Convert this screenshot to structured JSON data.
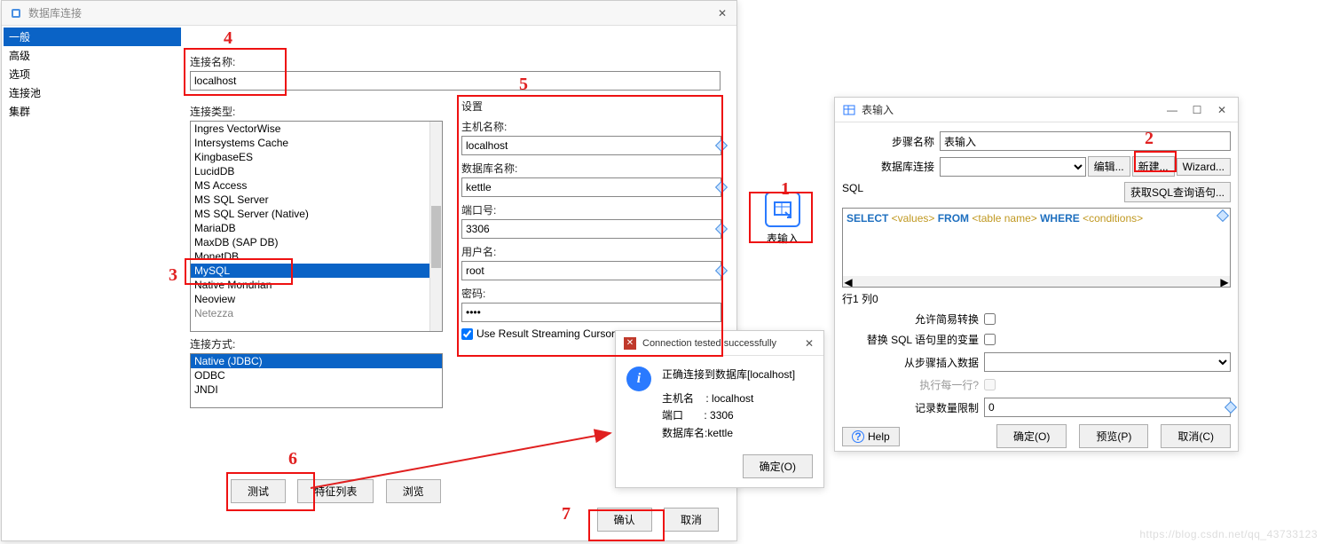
{
  "dbWindow": {
    "title": "数据库连接",
    "sidebar": [
      "一般",
      "高级",
      "选项",
      "连接池",
      "集群"
    ],
    "connNameLabel": "连接名称:",
    "connNameValue": "localhost",
    "connTypeLabel": "连接类型:",
    "dbTypes": [
      "Ingres VectorWise",
      "Intersystems Cache",
      "KingbaseES",
      "LucidDB",
      "MS Access",
      "MS SQL Server",
      "MS SQL Server (Native)",
      "MariaDB",
      "MaxDB (SAP DB)",
      "MonetDB",
      "MySQL",
      "Native Mondrian",
      "Neoview",
      "Netezza"
    ],
    "selectedDbTypeIndex": 10,
    "accessLabel": "连接方式:",
    "accessTypes": [
      "Native (JDBC)",
      "ODBC",
      "JNDI"
    ],
    "selectedAccessIndex": 0,
    "settings": {
      "header": "设置",
      "hostLabel": "主机名称:",
      "hostValue": "localhost",
      "dbnameLabel": "数据库名称:",
      "dbnameValue": "kettle",
      "portLabel": "端口号:",
      "portValue": "3306",
      "userLabel": "用户名:",
      "userValue": "root",
      "passLabel": "密码:",
      "passValue": "●●●●",
      "streamLabel": "Use Result Streaming Cursor"
    },
    "buttons": {
      "test": "测试",
      "feature": "特征列表",
      "browse": "浏览",
      "ok": "确认",
      "cancel": "取消"
    }
  },
  "msgBox": {
    "title": "Connection tested successfully",
    "line1": "正确连接到数据库[localhost]",
    "hostLabel": "主机名",
    "hostVal": ": localhost",
    "portLabel": "端口",
    "portVal": ": 3306",
    "dbLabel": "数据库名:",
    "dbVal": "kettle",
    "ok": "确定(O)"
  },
  "tableInputIcon": {
    "label": "表输入"
  },
  "tableInputDlg": {
    "title": "表输入",
    "winbtns": {
      "min": "—",
      "max": "☐",
      "close": "✕"
    },
    "stepNameLabel": "步骤名称",
    "stepNameValue": "表输入",
    "connLabel": "数据库连接",
    "editBtn": "编辑...",
    "newBtn": "新建...",
    "wizardBtn": "Wizard...",
    "sqlLabel": "SQL",
    "getSqlBtn": "获取SQL查询语句...",
    "sqlTokens": [
      "SELECT",
      " <values> ",
      "FROM",
      " <table name> ",
      "WHERE",
      " <conditions>"
    ],
    "status": "行1 列0",
    "allowLazy": "允许简易转换",
    "replaceVars": "替换 SQL 语句里的变量",
    "insertFromStep": "从步骤插入数据",
    "execEachRow": "执行每一行?",
    "limitLabel": "记录数量限制",
    "limitValue": "0",
    "help": "Help",
    "ok": "确定(O)",
    "preview": "预览(P)",
    "cancel": "取消(C)"
  },
  "annotations": {
    "n1": "1",
    "n2": "2",
    "n3": "3",
    "n4": "4",
    "n5": "5",
    "n6": "6",
    "n7": "7"
  }
}
